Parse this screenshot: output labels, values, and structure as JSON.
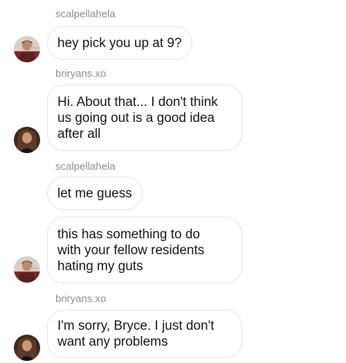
{
  "messages": [
    {
      "sender": "scalpellahela",
      "text": "hey pick you up at 9?",
      "avatar": "man-avatar"
    },
    {
      "sender": "briryans.xo",
      "text": "Hi. About that... I don't think\nus going out is a good idea\nafter all",
      "avatar": "woman-avatar"
    },
    {
      "sender": "scalpellahela",
      "text": "let me guess",
      "avatar": "none"
    },
    {
      "sender": "",
      "text": "this has something to do\nwith your fellow residents\nhating my guts",
      "avatar": "man-avatar"
    },
    {
      "sender": "briryans.xo",
      "text": "I'm sorry, Bryce. I just don't\nwant any problems",
      "avatar": "woman-avatar"
    }
  ]
}
